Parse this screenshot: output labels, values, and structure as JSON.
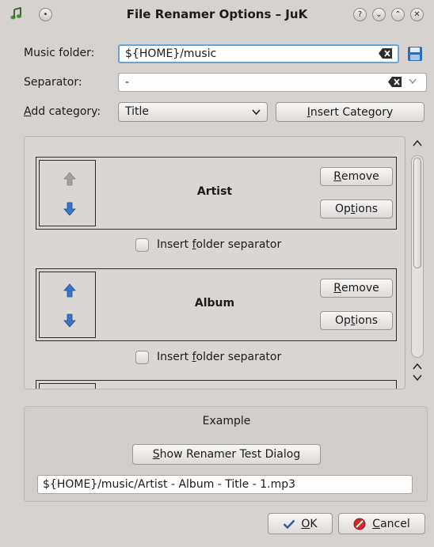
{
  "window": {
    "title": "File Renamer Options – JuK",
    "controls": {
      "help": "?",
      "minimize": "⌄",
      "maximize": "⌃",
      "close": "✕"
    }
  },
  "music_folder": {
    "label": "Music folder:",
    "value": "${HOME}/music"
  },
  "separator": {
    "label": "Separator:",
    "value": "-"
  },
  "add_category": {
    "label_accel": "A",
    "label_rest": "dd category:",
    "selected": "Title",
    "insert_accel": "I",
    "insert_rest": "nsert Category"
  },
  "categories": [
    {
      "name": "Artist",
      "remove_accel": "R",
      "remove_rest": "emove",
      "options_pre": "Op",
      "options_accel": "t",
      "options_rest": "ions",
      "up_enabled": false,
      "down_enabled": true
    },
    {
      "name": "Album",
      "remove_accel": "R",
      "remove_rest": "emove",
      "options_pre": "Op",
      "options_accel": "t",
      "options_rest": "ions",
      "up_enabled": true,
      "down_enabled": true
    }
  ],
  "folder_separator": {
    "pre": "Insert ",
    "accel": "f",
    "rest": "older separator",
    "checked": false
  },
  "example": {
    "title": "Example",
    "test_button_accel": "S",
    "test_button_rest": "how Renamer Test Dialog",
    "result": "${HOME}/music/Artist - Album - Title - 1.mp3"
  },
  "buttons": {
    "ok_accel": "O",
    "ok_rest": "K",
    "cancel_accel": "C",
    "cancel_rest": "ancel"
  },
  "icons": {
    "app": "juk-music-note-icon",
    "clear": "clear-text-icon",
    "save": "floppy-save-icon",
    "ok": "checkmark-icon",
    "cancel": "stop-icon"
  },
  "colors": {
    "arrow_enabled": "#3a74c4",
    "arrow_disabled": "#a4a09e",
    "focus_border": "#68a4d9",
    "cancel_red": "#d0272c"
  }
}
